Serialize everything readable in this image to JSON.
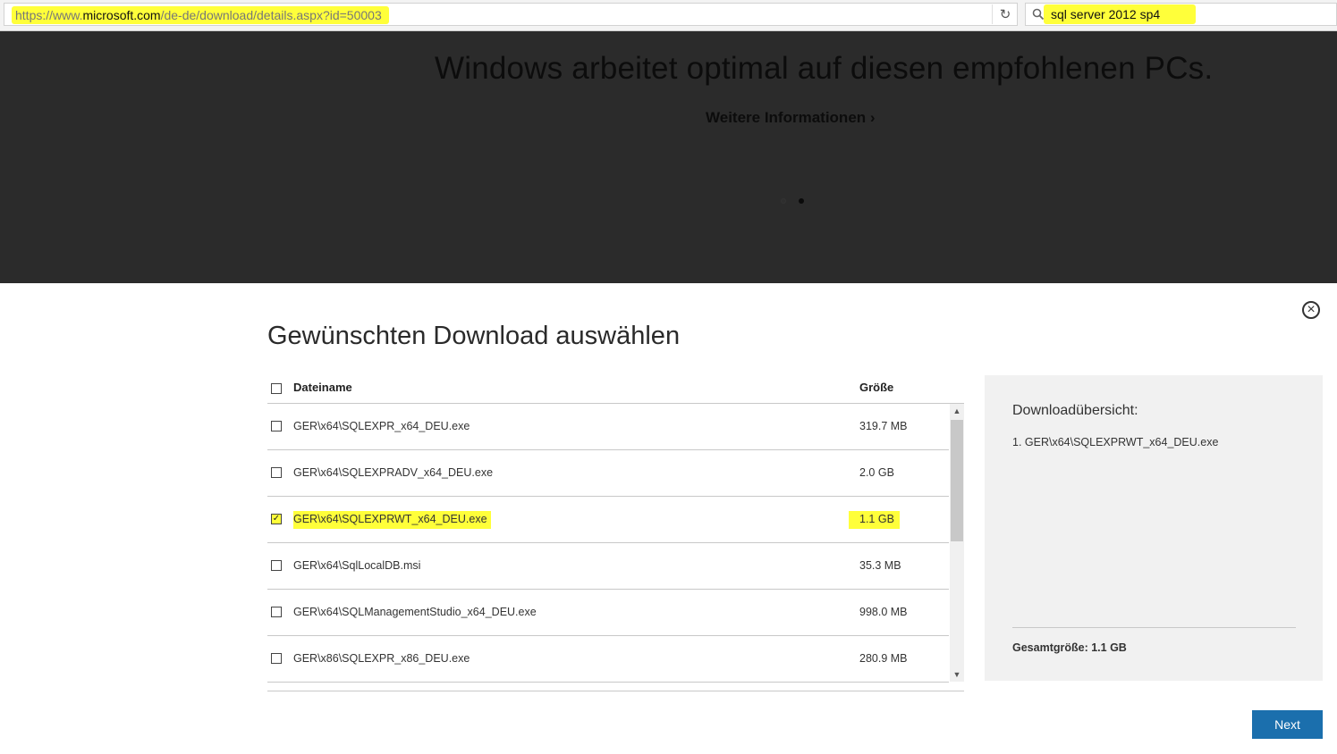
{
  "browser": {
    "url_prefix": "https://www.",
    "url_host": "microsoft.com",
    "url_path": "/de-de/download/details.aspx?id=50003",
    "search_query": "sql server 2012 sp4"
  },
  "hero": {
    "title": "Windows arbeitet optimal auf diesen empfohlenen PCs.",
    "link_label": "Weitere Informationen",
    "link_arrow": "›"
  },
  "dialog": {
    "title": "Gewünschten Download auswählen",
    "close_symbol": "×",
    "columns": {
      "name": "Dateiname",
      "size": "Größe"
    },
    "files": [
      {
        "name": "GER\\x64\\SQLEXPR_x64_DEU.exe",
        "size": "319.7 MB",
        "checked": false
      },
      {
        "name": "GER\\x64\\SQLEXPRADV_x64_DEU.exe",
        "size": "2.0 GB",
        "checked": false
      },
      {
        "name": "GER\\x64\\SQLEXPRWT_x64_DEU.exe",
        "size": "1.1 GB",
        "checked": true
      },
      {
        "name": "GER\\x64\\SqlLocalDB.msi",
        "size": "35.3 MB",
        "checked": false
      },
      {
        "name": "GER\\x64\\SQLManagementStudio_x64_DEU.exe",
        "size": "998.0 MB",
        "checked": false
      },
      {
        "name": "GER\\x86\\SQLEXPR_x86_DEU.exe",
        "size": "280.9 MB",
        "checked": false
      }
    ],
    "summary": {
      "title": "Downloadübersicht:",
      "items": [
        "1. GER\\x64\\SQLEXPRWT_x64_DEU.exe"
      ],
      "total": "Gesamtgröße: 1.1 GB"
    },
    "next_label": "Next"
  },
  "colors": {
    "highlight": "#ffff3a",
    "hero_background": "#2b2b2b",
    "summary_background": "#f1f1f1",
    "next_button": "#1b6fad"
  }
}
